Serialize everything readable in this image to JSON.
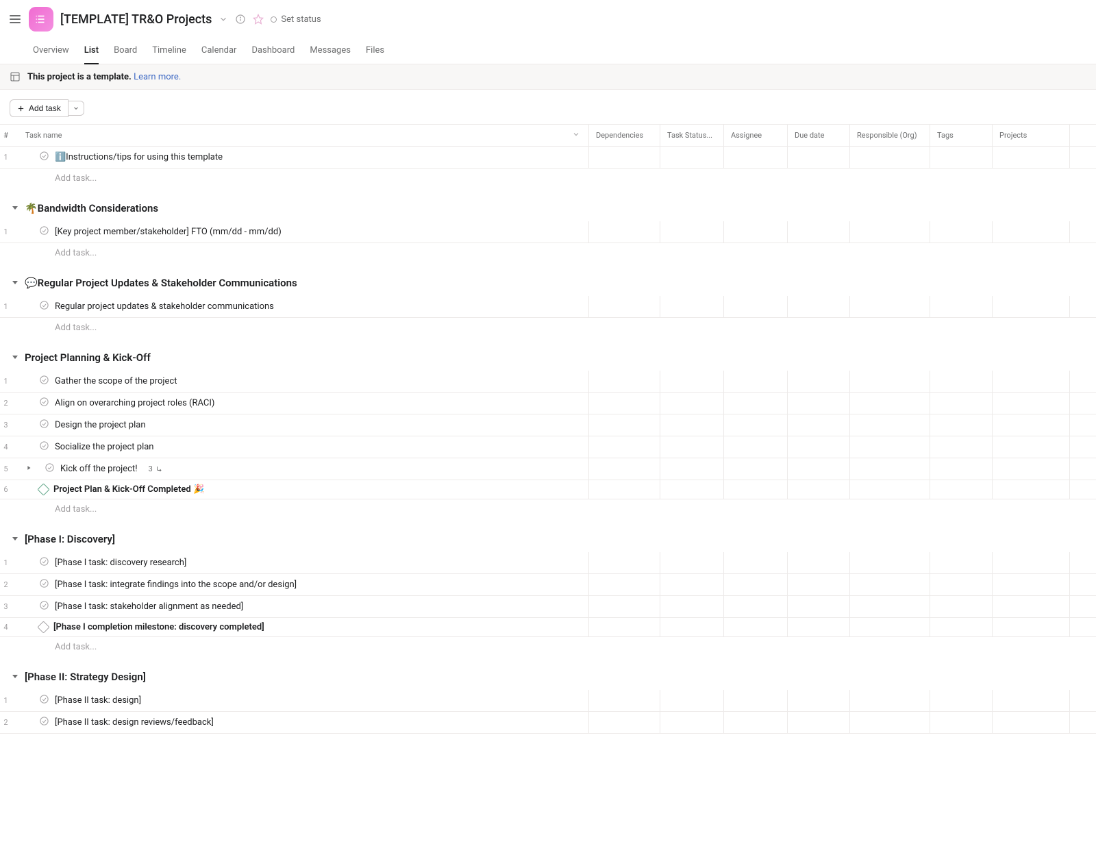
{
  "header": {
    "title": "[TEMPLATE] TR&O Projects",
    "set_status": "Set status"
  },
  "tabs": [
    "Overview",
    "List",
    "Board",
    "Timeline",
    "Calendar",
    "Dashboard",
    "Messages",
    "Files"
  ],
  "active_tab": "List",
  "banner": {
    "text": "This project is a template.",
    "link": "Learn more."
  },
  "toolbar": {
    "add_task": "Add task"
  },
  "columns": {
    "num": "#",
    "name": "Task name",
    "dep": "Dependencies",
    "status": "Task Status...",
    "assignee": "Assignee",
    "due": "Due date",
    "resp": "Responsible (Org)",
    "tags": "Tags",
    "projects": "Projects"
  },
  "add_task_placeholder": "Add task...",
  "sections": [
    {
      "title": null,
      "tasks": [
        {
          "num": "1",
          "name": "ℹ️Instructions/tips for using this template",
          "type": "task"
        }
      ]
    },
    {
      "title": "🌴Bandwidth Considerations",
      "tasks": [
        {
          "num": "1",
          "name": "[Key project member/stakeholder] FTO (mm/dd - mm/dd)",
          "type": "task"
        }
      ]
    },
    {
      "title": "💬Regular Project Updates & Stakeholder Communications",
      "tasks": [
        {
          "num": "1",
          "name": "Regular project updates & stakeholder communications",
          "type": "task"
        }
      ]
    },
    {
      "title": "Project Planning & Kick-Off",
      "tasks": [
        {
          "num": "1",
          "name": "Gather the scope of the project",
          "type": "task"
        },
        {
          "num": "2",
          "name": "Align on overarching project roles (RACI)",
          "type": "task"
        },
        {
          "num": "3",
          "name": "Design the project plan",
          "type": "task"
        },
        {
          "num": "4",
          "name": "Socialize the project plan",
          "type": "task"
        },
        {
          "num": "5",
          "name": "Kick off the project!",
          "type": "task",
          "subtasks": "3"
        },
        {
          "num": "6",
          "name": "Project Plan & Kick-Off Completed 🎉",
          "type": "milestone",
          "bold": true
        }
      ]
    },
    {
      "title": "[Phase I: Discovery]",
      "tasks": [
        {
          "num": "1",
          "name": "[Phase I task: discovery research]",
          "type": "task"
        },
        {
          "num": "2",
          "name": "[Phase I task: integrate findings into the scope and/or design]",
          "type": "task"
        },
        {
          "num": "3",
          "name": "[Phase I task: stakeholder alignment as needed]",
          "type": "task"
        },
        {
          "num": "4",
          "name": "[Phase I completion milestone: discovery completed]",
          "type": "milestone_gray",
          "bold": true
        }
      ]
    },
    {
      "title": "[Phase II: Strategy Design]",
      "no_add": true,
      "tasks": [
        {
          "num": "1",
          "name": "[Phase II task: design]",
          "type": "task"
        },
        {
          "num": "2",
          "name": "[Phase II task: design reviews/feedback]",
          "type": "task"
        }
      ]
    }
  ]
}
